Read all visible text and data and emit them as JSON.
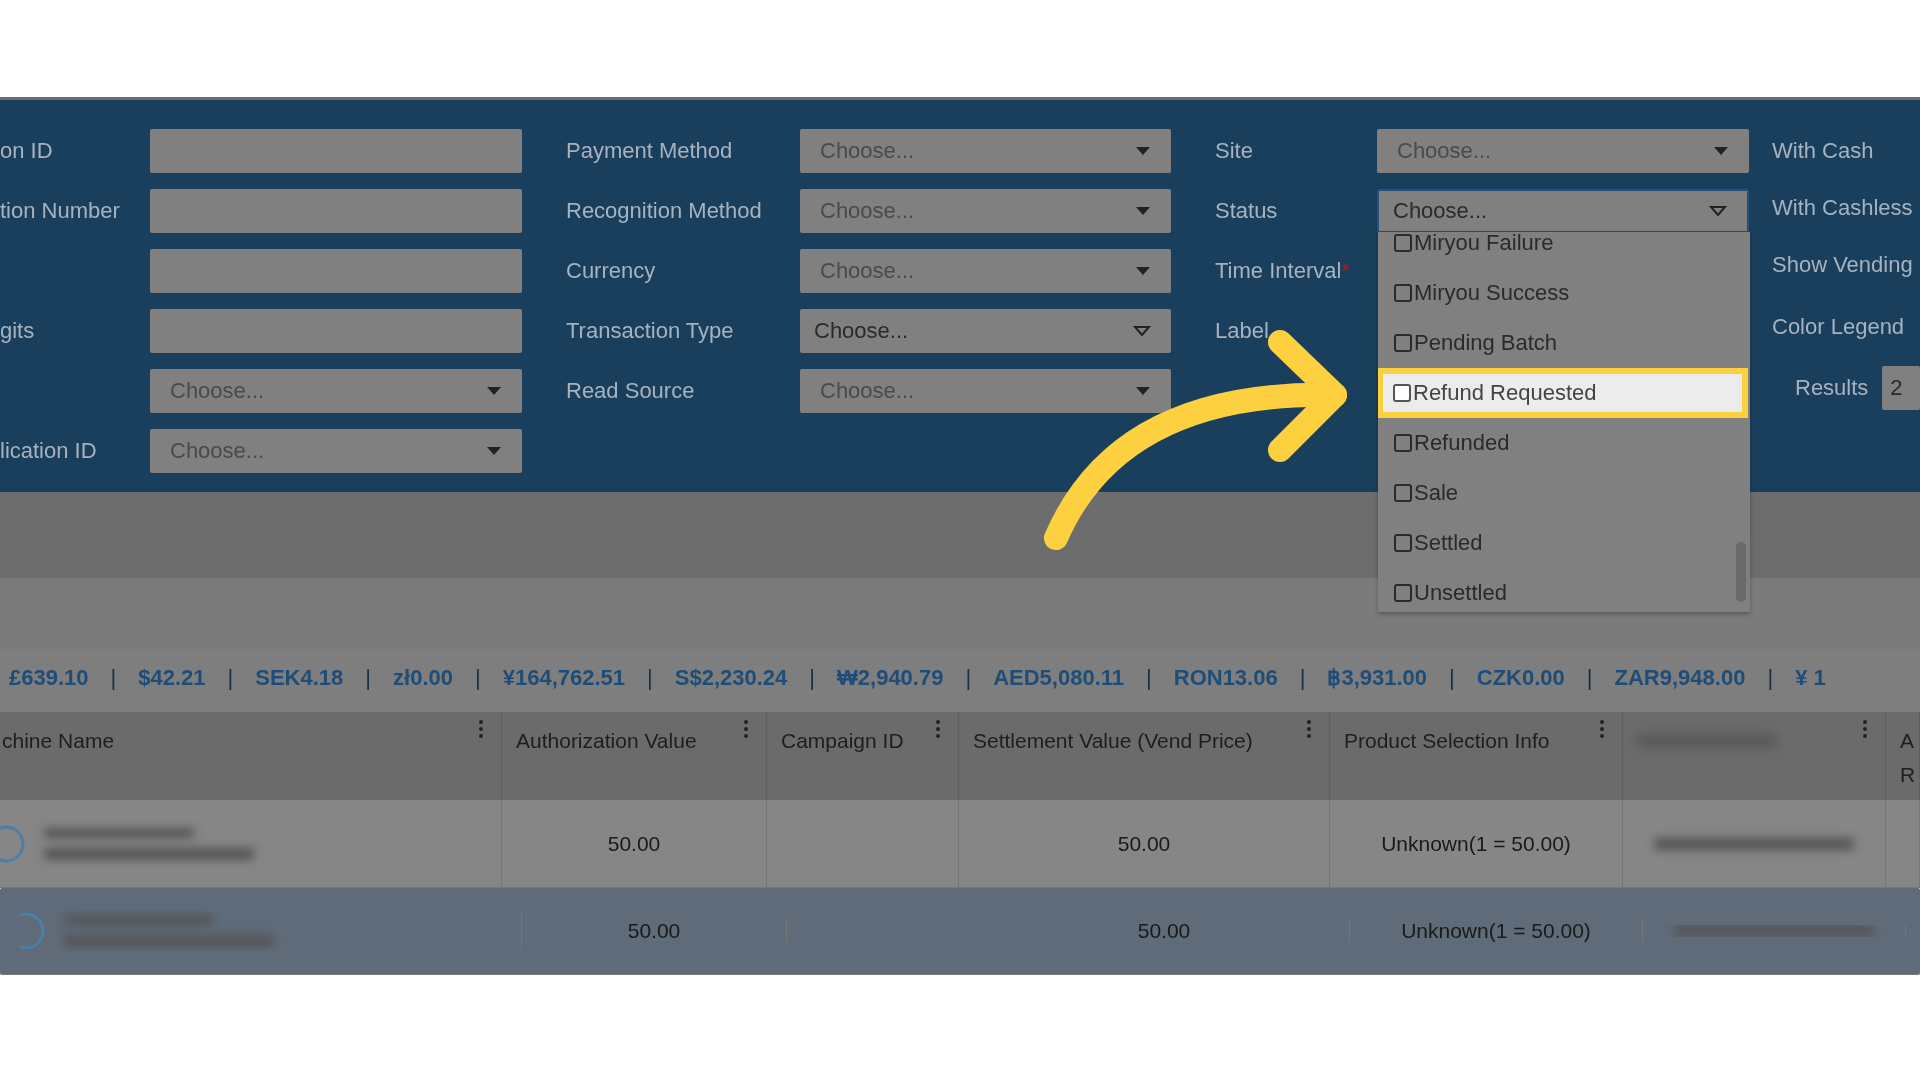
{
  "filters": {
    "columns": [
      {
        "fields": [
          {
            "label": "on ID",
            "kind": "text"
          },
          {
            "label": "tion Number",
            "kind": "text"
          },
          {
            "kind": "text"
          },
          {
            "label": "gits",
            "kind": "text"
          },
          {
            "kind": "select",
            "placeholder": "Choose..."
          },
          {
            "label": "lication ID",
            "kind": "select",
            "placeholder": "Choose..."
          }
        ]
      },
      {
        "fields": [
          {
            "label": "Payment Method",
            "kind": "select",
            "placeholder": "Choose..."
          },
          {
            "label": "Recognition Method",
            "kind": "select",
            "placeholder": "Choose..."
          },
          {
            "label": "Currency",
            "kind": "select",
            "placeholder": "Choose..."
          },
          {
            "label": "Transaction Type",
            "kind": "select-alt",
            "value": "Choose..."
          },
          {
            "label": "Read Source",
            "kind": "select",
            "placeholder": "Choose..."
          }
        ]
      },
      {
        "fields": [
          {
            "label": "Site",
            "kind": "select",
            "placeholder": "Choose..."
          },
          {
            "label": "Status",
            "kind": "select-alt",
            "value": "Choose...",
            "open": true
          },
          {
            "label": "Time Interval",
            "kind": "label",
            "required_mark": "*"
          },
          {
            "label": "Label",
            "kind": "label"
          }
        ]
      }
    ],
    "side": [
      {
        "label": "With Cash"
      },
      {
        "label": "With Cashless"
      },
      {
        "label": "Show Vending"
      },
      {
        "label": "Color Legend"
      }
    ],
    "results": {
      "label": "Results",
      "value": "2"
    }
  },
  "status_dropdown": {
    "options": [
      {
        "label": "Miryou Failure",
        "checked": false,
        "highlighted": false
      },
      {
        "label": "Miryou Success",
        "checked": false,
        "highlighted": false
      },
      {
        "label": "Pending Batch",
        "checked": false,
        "highlighted": false
      },
      {
        "label": "Refund Requested",
        "checked": false,
        "highlighted": true
      },
      {
        "label": "Refunded",
        "checked": false,
        "highlighted": false
      },
      {
        "label": "Sale",
        "checked": false,
        "highlighted": false
      },
      {
        "label": "Settled",
        "checked": false,
        "highlighted": false
      },
      {
        "label": "Unsettled",
        "checked": false,
        "highlighted": false
      }
    ]
  },
  "totals": [
    {
      "kind": "amount",
      "text": "£639.10"
    },
    {
      "kind": "separator",
      "text": "|"
    },
    {
      "kind": "amount",
      "text": "$42.21"
    },
    {
      "kind": "separator",
      "text": "|"
    },
    {
      "kind": "amount",
      "text": "SEK4.18"
    },
    {
      "kind": "separator",
      "text": "|"
    },
    {
      "kind": "amount",
      "text": "zł0.00"
    },
    {
      "kind": "separator",
      "text": "|"
    },
    {
      "kind": "amount",
      "text": "¥164,762.51"
    },
    {
      "kind": "separator",
      "text": "|"
    },
    {
      "kind": "amount",
      "text": "S$2,230.24"
    },
    {
      "kind": "separator",
      "text": "|"
    },
    {
      "kind": "amount",
      "text": "₩2,940.79"
    },
    {
      "kind": "separator",
      "text": "|"
    },
    {
      "kind": "amount",
      "text": "AED5,080.11"
    },
    {
      "kind": "separator",
      "text": "|"
    },
    {
      "kind": "amount",
      "text": "RON13.06"
    },
    {
      "kind": "separator",
      "text": "|"
    },
    {
      "kind": "amount",
      "text": "฿3,931.00"
    },
    {
      "kind": "separator",
      "text": "|"
    },
    {
      "kind": "amount",
      "text": "CZK0.00"
    },
    {
      "kind": "separator",
      "text": "|"
    },
    {
      "kind": "amount",
      "text": "ZAR9,948.00"
    },
    {
      "kind": "separator",
      "text": "|"
    },
    {
      "kind": "amount",
      "text": "¥ 1"
    }
  ],
  "table": {
    "columns": [
      {
        "label": "chine Name",
        "menu": true
      },
      {
        "label": "Authorization Value",
        "menu": true
      },
      {
        "label": "Campaign ID",
        "menu": true
      },
      {
        "label": "Settlement Value (Vend Price)",
        "menu": true
      },
      {
        "label": "Product Selection Info",
        "menu": true
      },
      {
        "menu": true,
        "redacted": true
      },
      {
        "label": "A R",
        "menu": false
      }
    ],
    "rows": [
      {
        "selected": false,
        "cells": [
          "",
          "50.00",
          "",
          "50.00",
          "Unknown(1 = 50.00)",
          "",
          ""
        ]
      },
      {
        "selected": true,
        "cells": [
          "",
          "50.00",
          "",
          "50.00",
          "Unknown(1 = 50.00)",
          "",
          ""
        ]
      }
    ]
  }
}
